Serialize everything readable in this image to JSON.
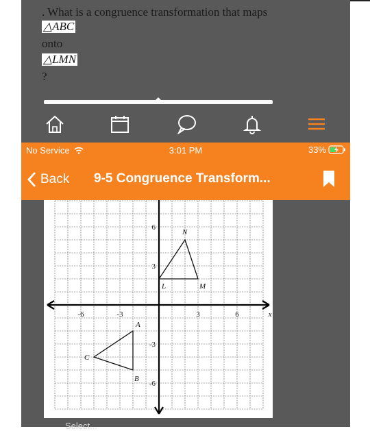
{
  "question": {
    "prefix": ". What is a congruence transformation that maps",
    "from_triangle": "△ABC",
    "connector": "onto",
    "to_triangle": "△LMN",
    "suffix": "?"
  },
  "status_bar": {
    "carrier": "No Service",
    "time": "3:01 PM",
    "battery": "33%"
  },
  "toolbar": {
    "icons": [
      "home-icon",
      "calendar-icon",
      "chat-bubble-icon",
      "bell-icon",
      "menu-icon"
    ]
  },
  "nav": {
    "back_label": "Back",
    "title": "9-5 Congruence Transform..."
  },
  "figure": {
    "x_axis_label": "x",
    "x_ticks": [
      "-6",
      "-3",
      "3",
      "6"
    ],
    "y_ticks": [
      "6",
      "3",
      "-3",
      "-6"
    ],
    "triangle_abc": {
      "A": {
        "label": "A",
        "x": -2,
        "y": -2
      },
      "B": {
        "label": "B",
        "x": -2,
        "y": -5
      },
      "C": {
        "label": "C",
        "x": -5,
        "y": -4
      }
    },
    "triangle_lmn": {
      "L": {
        "label": "L",
        "x": 0,
        "y": 2
      },
      "M": {
        "label": "M",
        "x": 3,
        "y": 2
      },
      "N": {
        "label": "N",
        "x": 2,
        "y": 5
      }
    }
  },
  "footer_partial_text": "Select...",
  "colors": {
    "accent_orange": "#f5821f",
    "background_gray": "#595959"
  }
}
